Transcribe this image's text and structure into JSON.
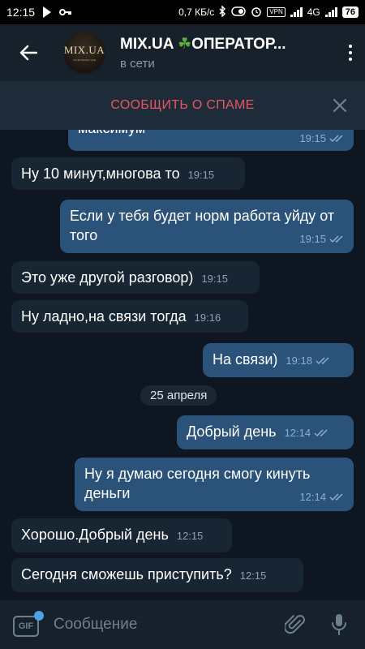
{
  "status_bar": {
    "time": "12:15",
    "speed": "0,7 КБ/с",
    "network": "4G",
    "battery": "76",
    "vpn": "VPN"
  },
  "header": {
    "title_part1": "MIX.UA ",
    "title_emoji": "☘",
    "title_part2": "ОПЕРАТОР...",
    "status": "в сети",
    "avatar_logo": "MIX.UA",
    "avatar_subtext": "YOUR DIGITAL LIFE"
  },
  "spam_bar": {
    "label": "СООБЩИТЬ О СПАМЕ"
  },
  "date_separator": "25 апреля",
  "messages": [
    {
      "text": "максимум",
      "time": "19:15",
      "outgoing": true,
      "read": true
    },
    {
      "text": "Ну 10 минут,многова то",
      "time": "19:15",
      "outgoing": false
    },
    {
      "text": "Если у тебя будет норм работа уйду от того",
      "time": "19:15",
      "outgoing": true,
      "read": true
    },
    {
      "text": "Это уже другой разговор)",
      "time": "19:15",
      "outgoing": false
    },
    {
      "text": "Ну ладно,на связи тогда",
      "time": "19:16",
      "outgoing": false
    },
    {
      "text": "На связи)",
      "time": "19:18",
      "outgoing": true,
      "read": true
    },
    {
      "text": "Добрый день",
      "time": "12:14",
      "outgoing": true,
      "read": true
    },
    {
      "text": "Ну я думаю сегодня смогу кинуть деньги",
      "time": "12:14",
      "outgoing": true,
      "read": true
    },
    {
      "text": "Хорошо.Добрый день",
      "time": "12:15",
      "outgoing": false
    },
    {
      "text": "Сегодня сможешь приступить?",
      "time": "12:15",
      "outgoing": false
    }
  ],
  "input": {
    "placeholder": "Сообщение",
    "gif_label": "GIF"
  },
  "colors": {
    "background": "#0e1621",
    "header": "#17212b",
    "incoming_bubble": "#182533",
    "outgoing_bubble": "#2b5278",
    "spam_text": "#e7555f",
    "accent": "#4ca3e0"
  },
  "icons": {
    "back": "arrow-left-icon",
    "menu": "more-vertical-icon",
    "close": "close-icon",
    "attach": "paperclip-icon",
    "mic": "microphone-icon",
    "read": "double-check-icon"
  }
}
